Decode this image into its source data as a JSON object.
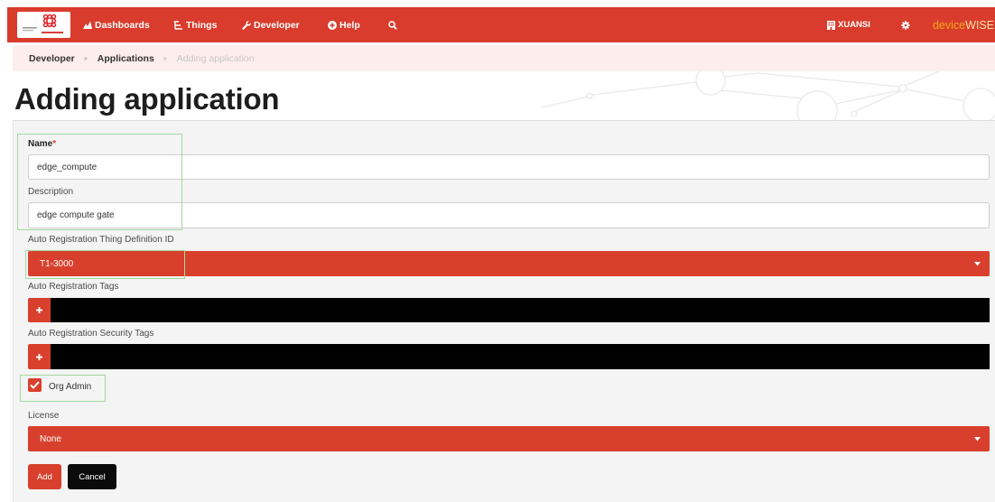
{
  "colors": {
    "primary": "#d93c2c",
    "breadcrumb_bg": "#fdeeed",
    "brand_device": "#f5a81c",
    "annotation": "#a3d99f"
  },
  "nav": {
    "items": [
      {
        "label": "Dashboards",
        "icon": "area-chart-icon"
      },
      {
        "label": "Things",
        "icon": "hierarchy-icon"
      },
      {
        "label": "Developer",
        "icon": "wrench-icon"
      },
      {
        "label": "Help",
        "icon": "plus-circle-icon"
      }
    ],
    "search_icon": "search-icon",
    "org_label": "XUANSI",
    "org_icon": "building-icon",
    "settings_icon": "gear-icon",
    "brand": {
      "device": "device",
      "wise": "WISE"
    }
  },
  "breadcrumb": [
    "Developer",
    "Applications",
    "Adding application"
  ],
  "page_title": "Adding application",
  "form": {
    "name": {
      "label": "Name",
      "required": "*",
      "value": "edge_compute"
    },
    "description": {
      "label": "Description",
      "value": "edge compute gate"
    },
    "thing_definition": {
      "label": "Auto Registration Thing Definition ID",
      "selected": "T1-3000"
    },
    "tags": {
      "label": "Auto Registration Tags",
      "add_icon": "plus-icon"
    },
    "security_tags": {
      "label": "Auto Registration Security Tags",
      "add_icon": "plus-icon"
    },
    "org_admin": {
      "label": "Org Admin",
      "checked": true
    },
    "license": {
      "label": "License",
      "selected": "None"
    },
    "add_button": "Add",
    "cancel_button": "Cancel"
  }
}
